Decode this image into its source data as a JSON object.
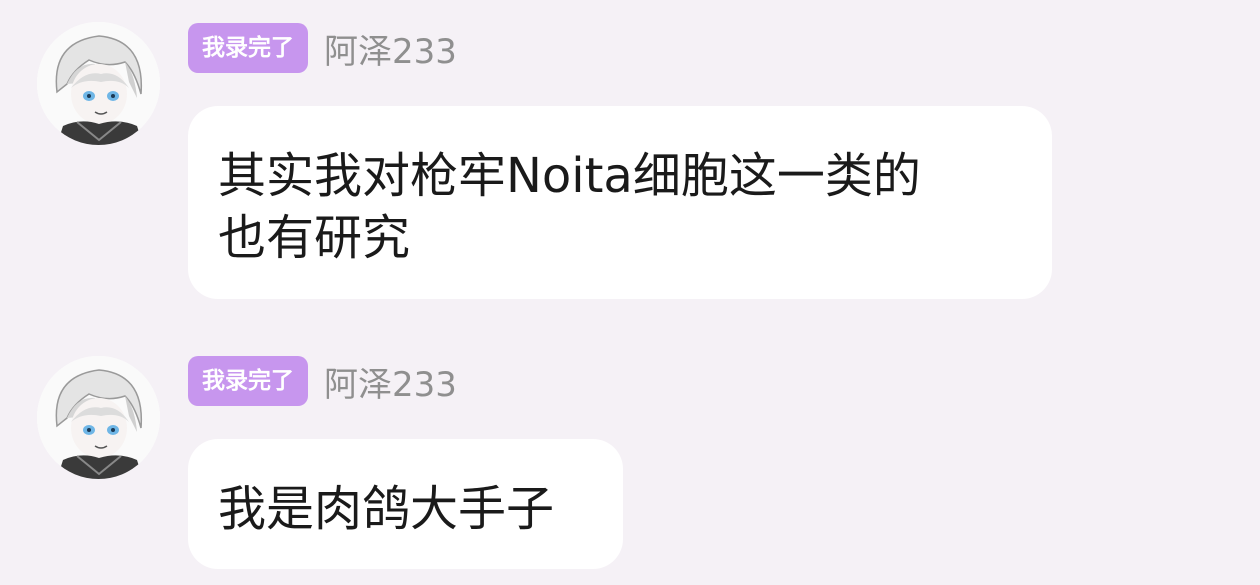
{
  "messages": [
    {
      "badge": "我录完了",
      "sender": "阿泽233",
      "lines": [
        "其实我对枪牢Noita细胞这一类的",
        "也有研究"
      ]
    },
    {
      "badge": "我录完了",
      "sender": "阿泽233",
      "lines": [
        "我是肉鸽大手子"
      ]
    }
  ],
  "colors": {
    "background": "#f5f1f6",
    "badge": "#c796ee",
    "bubble": "#ffffff",
    "sender": "#8f8f8f"
  }
}
